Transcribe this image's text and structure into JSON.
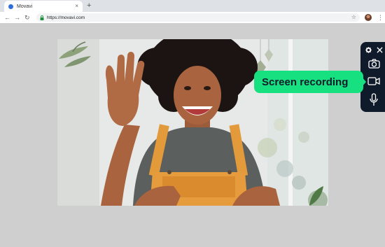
{
  "browser": {
    "tab_title": "Movavi",
    "tab_close": "×",
    "new_tab": "+",
    "back": "←",
    "forward": "→",
    "reload": "↻",
    "url": "https://movavi.com",
    "star": "☆",
    "menu": "⋮"
  },
  "recorder": {
    "callout_label": "Screen recording",
    "icons": [
      "gear-icon",
      "close-icon",
      "camera-icon",
      "screen-recording-icon",
      "microphone-icon"
    ]
  },
  "colors": {
    "accent": "#16e07f",
    "panel": "#0f1a2a",
    "page_background": "#cfcfcf"
  }
}
